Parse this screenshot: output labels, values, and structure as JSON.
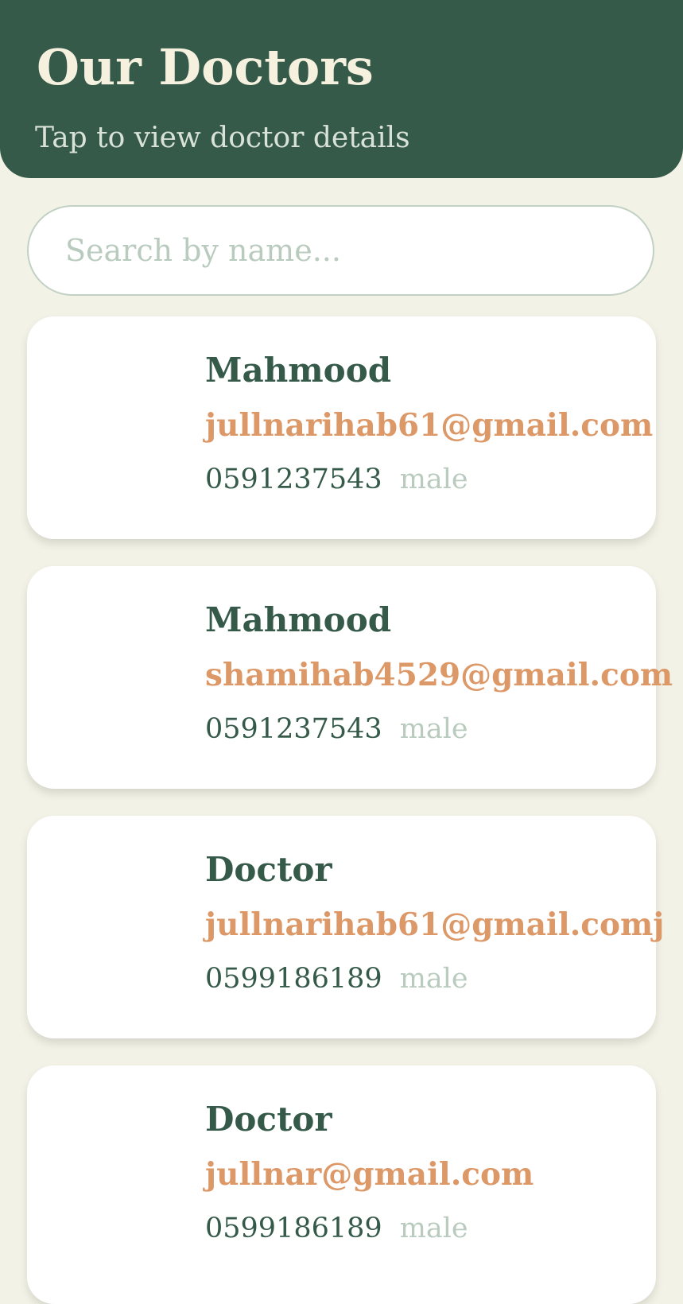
{
  "header": {
    "title": "Our Doctors",
    "subtitle": "Tap to view doctor details"
  },
  "search": {
    "placeholder": "Search by name...",
    "value": ""
  },
  "doctors": [
    {
      "name": "Mahmood",
      "email": "jullnarihab61@gmail.com",
      "phone": "0591237543",
      "gender": "male"
    },
    {
      "name": "Mahmood",
      "email": "shamihab4529@gmail.com",
      "phone": "0591237543",
      "gender": "male"
    },
    {
      "name": "Doctor",
      "email": "jullnarihab61@gmail.comj",
      "phone": "0599186189",
      "gender": "male"
    },
    {
      "name": "Doctor",
      "email": "jullnar@gmail.com",
      "phone": "0599186189",
      "gender": "male"
    }
  ],
  "colors": {
    "header_bg": "#355a49",
    "page_bg": "#f3f2e7",
    "email_accent": "#dc9867",
    "muted": "#b9cbbe"
  }
}
